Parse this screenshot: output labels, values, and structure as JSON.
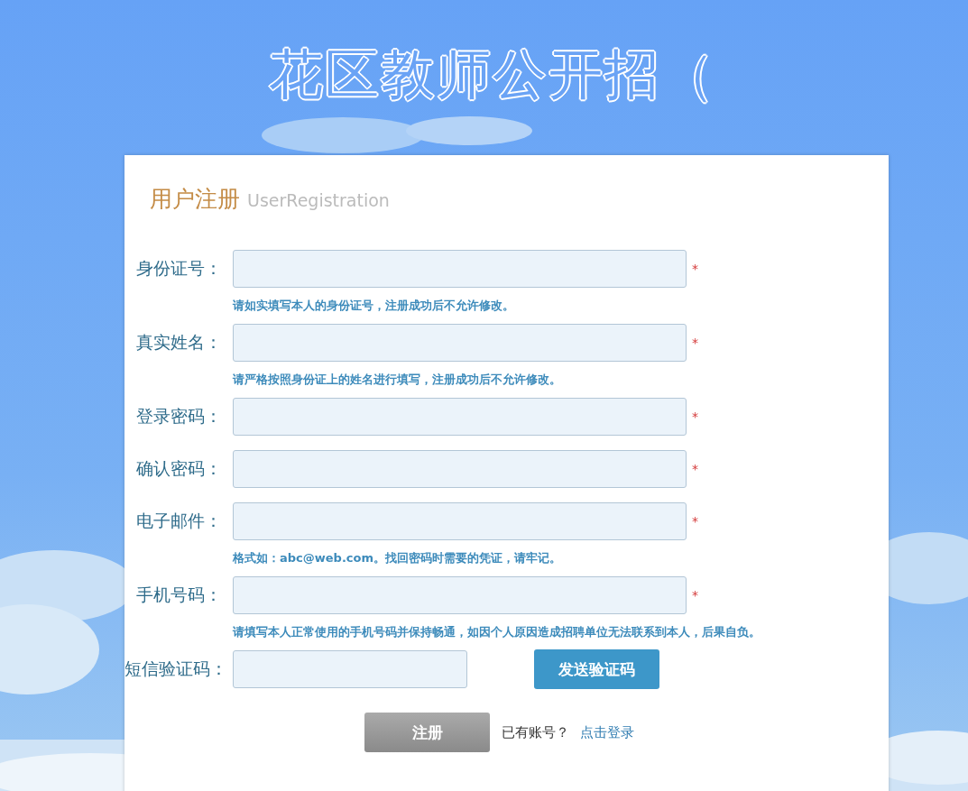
{
  "header": {
    "title": "花区教师公开招（"
  },
  "form": {
    "title": "用户注册",
    "subtitle": "UserRegistration",
    "fields": [
      {
        "kind": "text",
        "label": "身份证号：",
        "required_mark": "*",
        "hint": "请如实填写本人的身份证号，注册成功后不允许修改。"
      },
      {
        "kind": "text",
        "label": "真实姓名：",
        "required_mark": "*",
        "hint": "请严格按照身份证上的姓名进行填写，注册成功后不允许修改。"
      },
      {
        "kind": "password",
        "label": "登录密码：",
        "required_mark": "*"
      },
      {
        "kind": "password",
        "label": "确认密码：",
        "required_mark": "*"
      },
      {
        "kind": "text",
        "label": "电子邮件：",
        "required_mark": "*",
        "hint": "格式如：**abc@web.com**。找回密码时需要的凭证，请牢记。"
      },
      {
        "kind": "text",
        "label": "手机号码：",
        "required_mark": "*",
        "hint": "请填写本人正常使用的手机号码并保持畅通，如因个人原因造成招聘单位无法联系到本人，后果自负。"
      },
      {
        "kind": "code",
        "label": "短信验证码：",
        "button": "发送验证码"
      }
    ],
    "submit": "注册",
    "login_prompt": "已有账号？",
    "login_link": "点击登录"
  }
}
